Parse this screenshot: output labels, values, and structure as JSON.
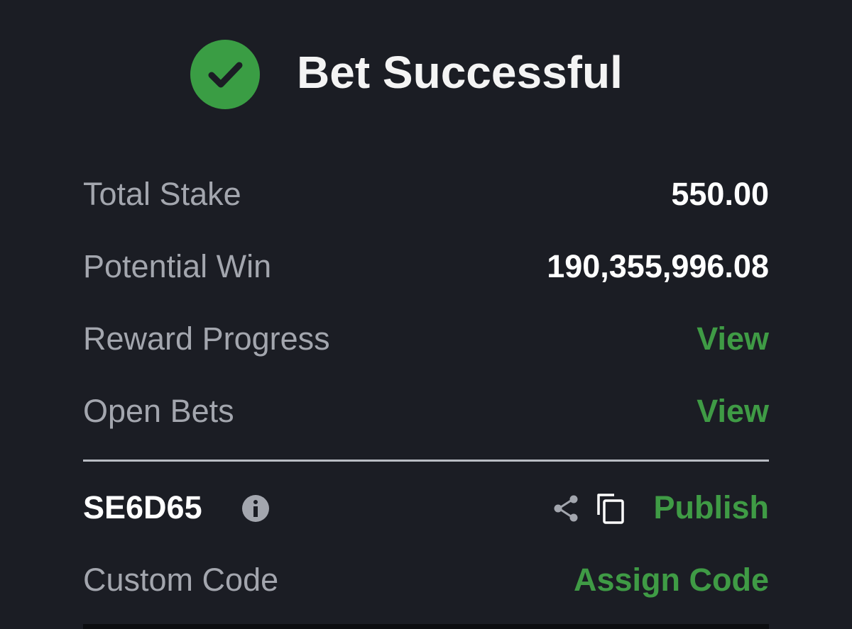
{
  "header": {
    "title": "Bet Successful",
    "status_icon": "check-circle-icon",
    "accent_color": "#3a9d44"
  },
  "summary": {
    "total_stake_label": "Total Stake",
    "total_stake_value": "550.00",
    "potential_win_label": "Potential Win",
    "potential_win_value": "190,355,996.08",
    "reward_progress_label": "Reward Progress",
    "reward_progress_link": "View",
    "open_bets_label": "Open Bets",
    "open_bets_link": "View"
  },
  "booking": {
    "code": "SE6D65",
    "info_icon": "info-icon",
    "share_icon": "share-icon",
    "copy_icon": "copy-icon",
    "publish_label": "Publish",
    "custom_code_label": "Custom Code",
    "assign_code_label": "Assign Code"
  },
  "colors": {
    "background": "#1b1d24",
    "label": "#a3a6ae",
    "value": "#ffffff",
    "link": "#3f9b45"
  }
}
